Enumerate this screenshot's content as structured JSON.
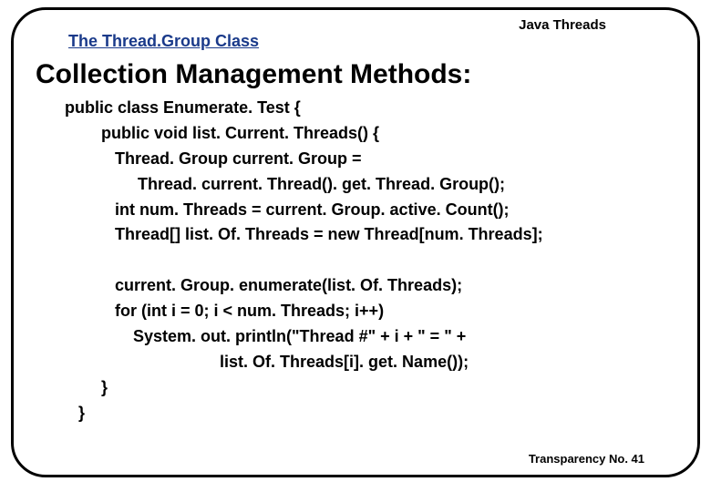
{
  "header": {
    "topic": "Java Threads",
    "subtitle": "The Thread.Group Class"
  },
  "heading": "Collection Management Methods:",
  "code": {
    "l1": "public class Enumerate. Test {",
    "l2": "        public void list. Current. Threads() {",
    "l3": "           Thread. Group current. Group =",
    "l4": "                Thread. current. Thread(). get. Thread. Group();",
    "l5": "           int num. Threads = current. Group. active. Count();",
    "l6": "           Thread[] list. Of. Threads = new Thread[num. Threads];",
    "l7": "",
    "l8": "           current. Group. enumerate(list. Of. Threads);",
    "l9": "           for (int i = 0; i < num. Threads; i++)",
    "l10": "               System. out. println(\"Thread #\" + i + \" = \" +",
    "l11": "                                  list. Of. Threads[i]. get. Name());",
    "l12": "        }",
    "l13": "   }"
  },
  "footer": {
    "transparency": "Transparency No. 41"
  }
}
